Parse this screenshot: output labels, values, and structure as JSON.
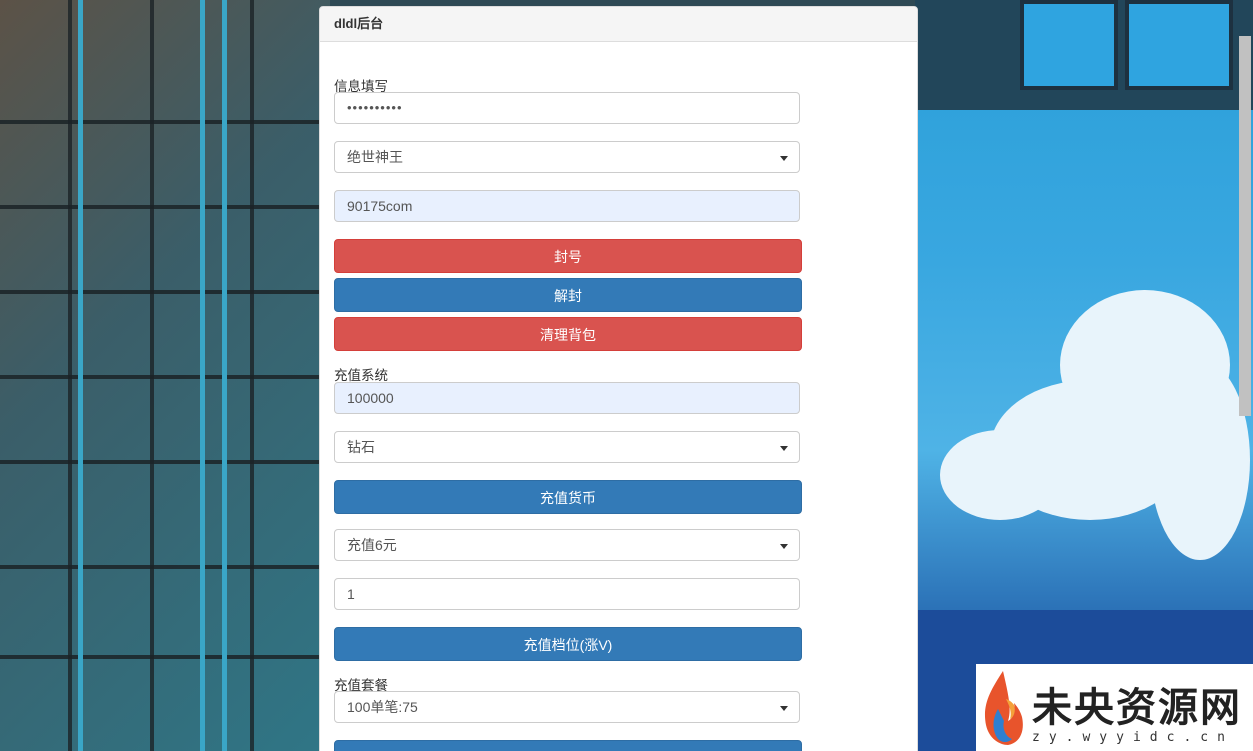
{
  "panel": {
    "title": "dldl后台"
  },
  "account_section": {
    "label": "信息填写",
    "password_value": "••••••••••",
    "server_select": "绝世神王",
    "account_value": "90175com",
    "ban_button": "封号",
    "unban_button": "解封",
    "clear_bag_button": "清理背包"
  },
  "recharge_section": {
    "label": "充值系统",
    "amount_value": "100000",
    "currency_select": "钻石",
    "recharge_currency_button": "充值货币",
    "tier_select": "充值6元",
    "tier_count_value": "1",
    "tier_button": "充值档位(涨V)"
  },
  "package_section": {
    "label": "充值套餐",
    "package_select": "100单笔:75"
  },
  "watermark": {
    "text": "未央资源网",
    "sub": "zy.wyyidc.cn"
  },
  "colors": {
    "danger": "#d9534f",
    "primary": "#337ab7",
    "autofill": "#e8f0fe"
  }
}
